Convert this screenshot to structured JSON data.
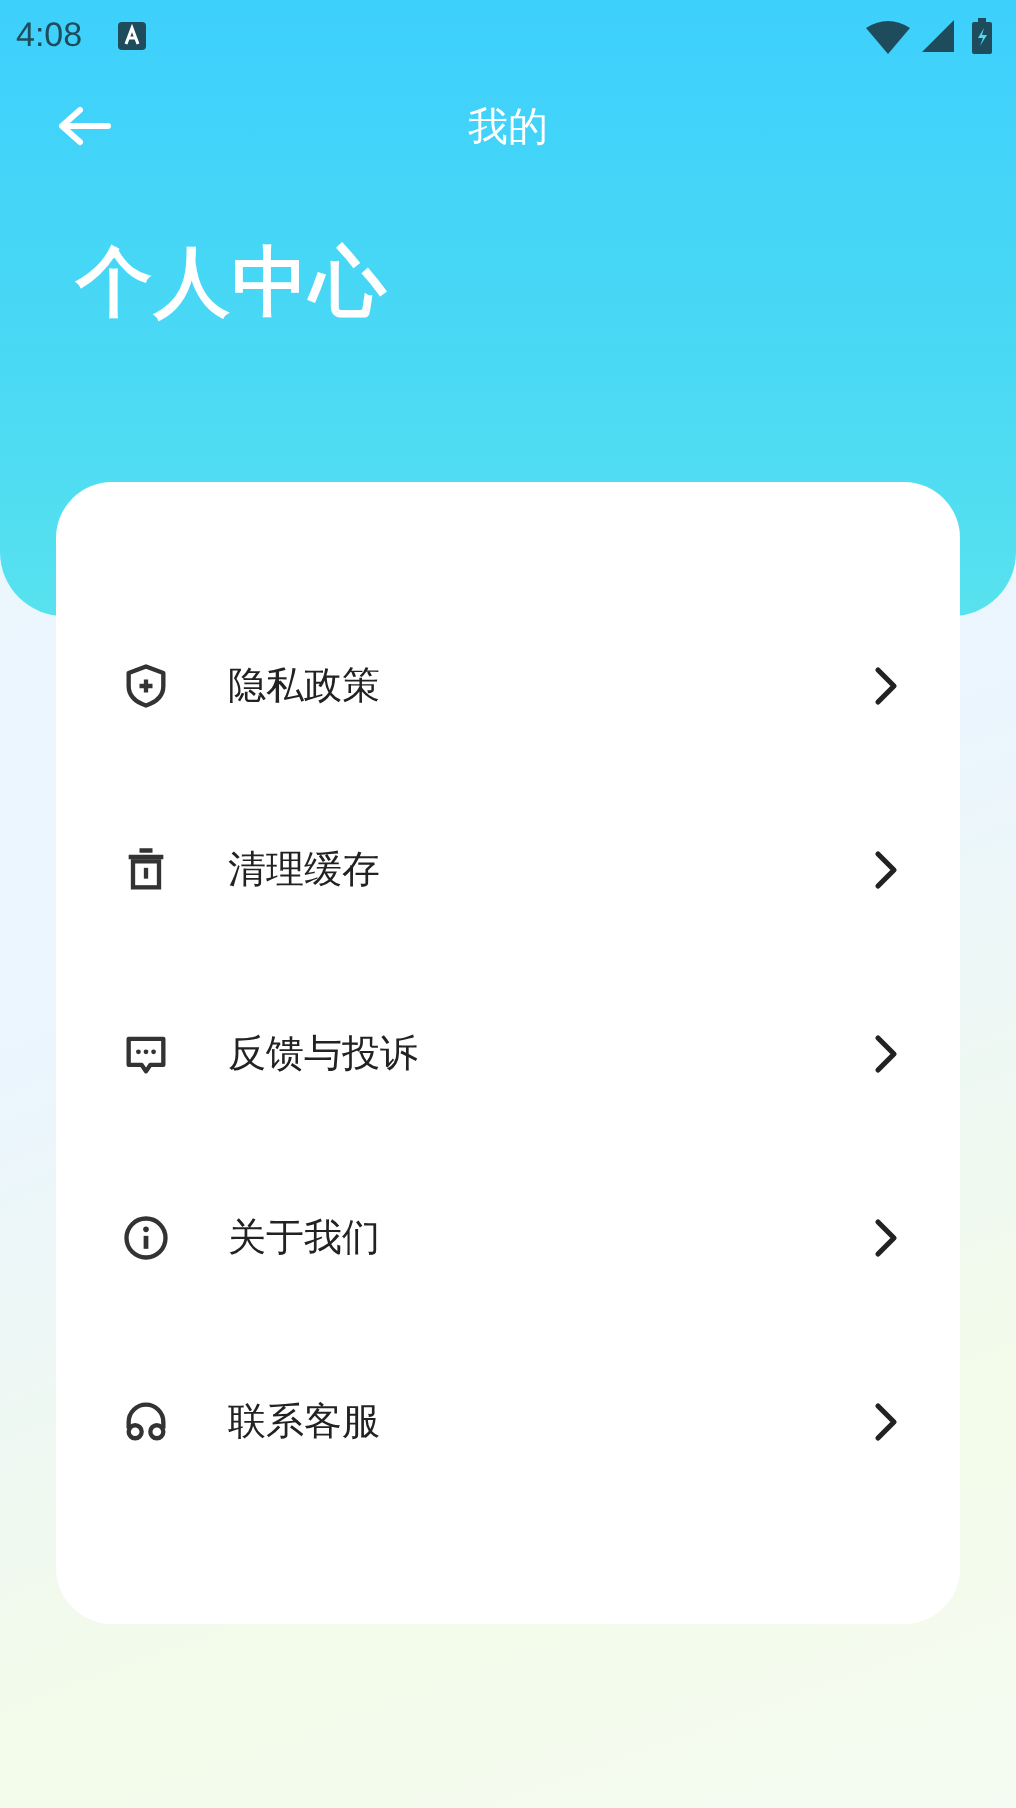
{
  "status_bar": {
    "time": "4:08"
  },
  "nav": {
    "title": "我的"
  },
  "header": {
    "title": "个人中心"
  },
  "menu": [
    {
      "kind": "shield",
      "label": "隐私政策"
    },
    {
      "kind": "trash",
      "label": "清理缓存"
    },
    {
      "kind": "chat",
      "label": "反馈与投诉"
    },
    {
      "kind": "info",
      "label": "关于我们"
    },
    {
      "kind": "headset",
      "label": "联系客服"
    }
  ]
}
